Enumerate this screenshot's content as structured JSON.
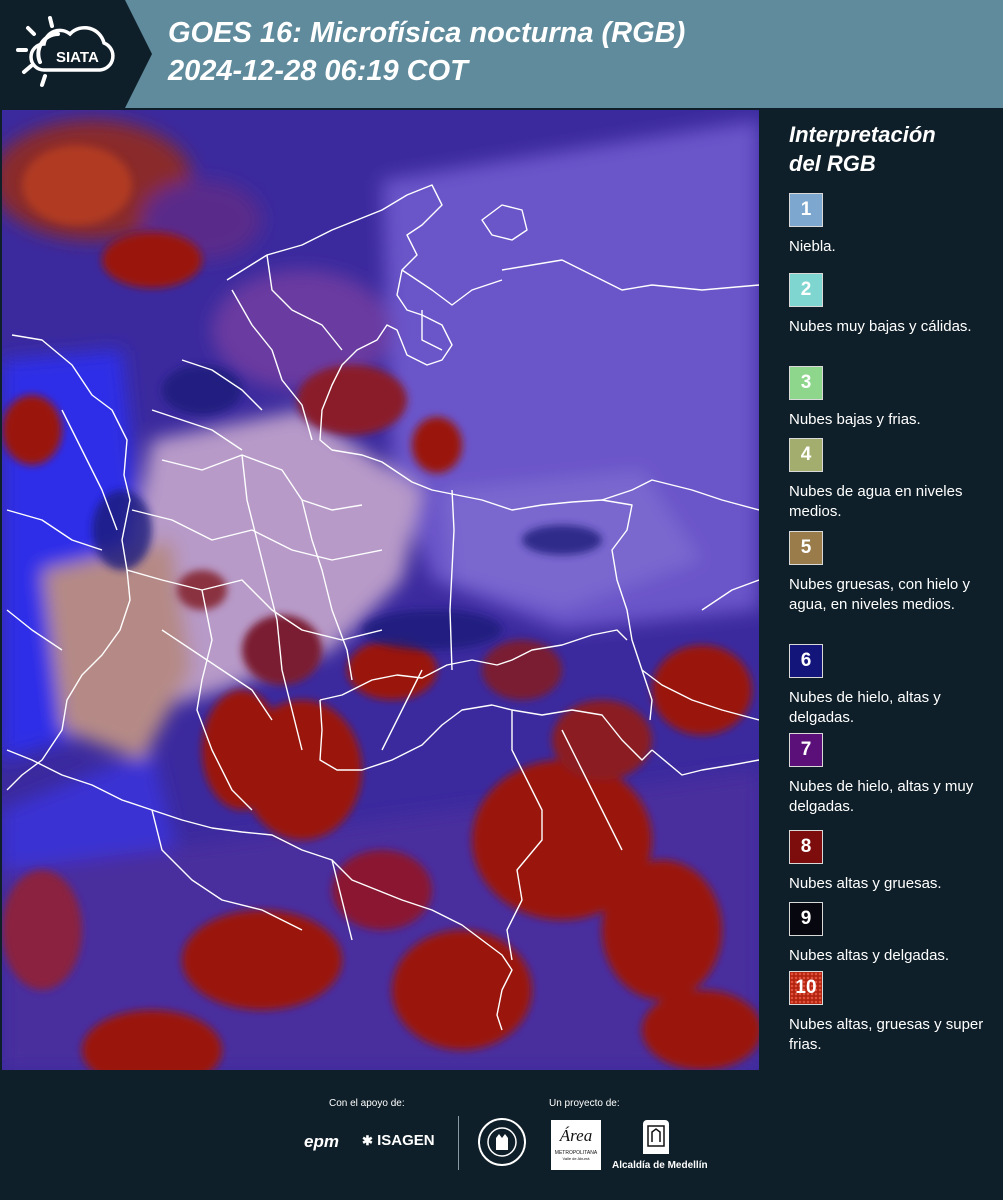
{
  "header": {
    "logo_text": "SIATA",
    "title_line1": "GOES 16: Microfísica nocturna (RGB)",
    "title_line2": " 2024-12-28 06:19 COT"
  },
  "colors": {
    "header_bg": "#5f8b9c",
    "page_bg": "#0f1f29",
    "map_base_blue": "#3b2a9e",
    "map_red": "#9a1410",
    "map_purple": "#6a4fc0",
    "border_white": "#ffffff"
  },
  "legend": {
    "title_line1": "Interpretación",
    "title_line2": "del RGB",
    "items": [
      {
        "number": "1",
        "color": "#7ea7cf",
        "label": "Niebla."
      },
      {
        "number": "2",
        "color": "#7fd6d0",
        "label": "Nubes muy bajas y cálidas."
      },
      {
        "number": "3",
        "color": "#8ed68c",
        "label": "Nubes bajas y frias."
      },
      {
        "number": "4",
        "color": "#a3ad6e",
        "label": "Nubes de agua en niveles medios."
      },
      {
        "number": "5",
        "color": "#9a7c4a",
        "label": "Nubes gruesas, con hielo y agua, en niveles medios."
      },
      {
        "number": "6",
        "color": "#13157a",
        "label": "Nubes de hielo, altas y delgadas."
      },
      {
        "number": "7",
        "color": "#5b0f78",
        "label": "Nubes de hielo, altas y muy delgadas."
      },
      {
        "number": "8",
        "color": "#7d0d0d",
        "label": "Nubes altas y gruesas."
      },
      {
        "number": "9",
        "color": "#07070f",
        "label": "Nubes altas y delgadas."
      },
      {
        "number": "10",
        "color": "#b32410",
        "label": "Nubes altas, gruesas y super frias."
      }
    ]
  },
  "footer": {
    "support_label": "Con el apoyo de:",
    "project_label": "Un proyecto de:",
    "epm": "epm",
    "isagen": "ISAGEN",
    "area_name": "Área",
    "area_sub": "METROPOLITANA",
    "area_sub2": "Valle de Aburrá",
    "alcaldia": "Alcaldía de Medellín"
  }
}
